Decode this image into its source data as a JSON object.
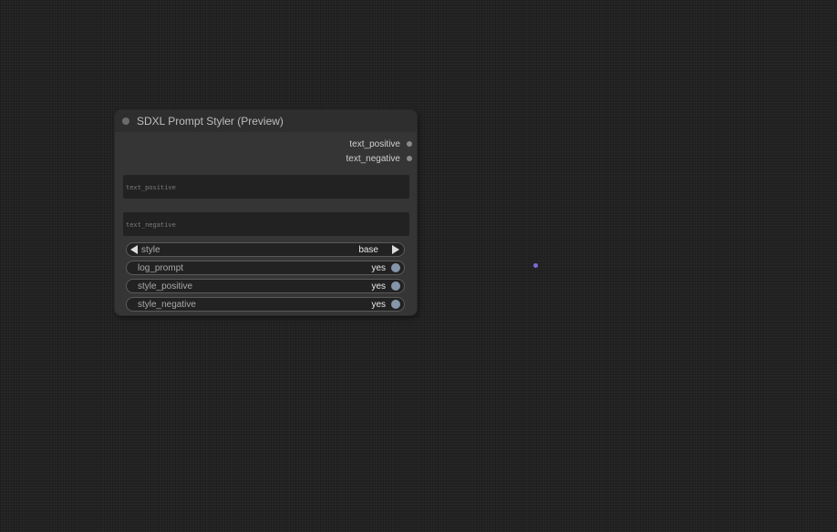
{
  "node": {
    "title": "SDXL Prompt Styler (Preview)",
    "outputs": [
      {
        "label": "text_positive"
      },
      {
        "label": "text_negative"
      }
    ],
    "textareas": [
      {
        "placeholder": "text_positive"
      },
      {
        "placeholder": "text_negative"
      }
    ],
    "combo": {
      "label": "style",
      "value": "base"
    },
    "toggles": [
      {
        "label": "log_prompt",
        "value": "yes"
      },
      {
        "label": "style_positive",
        "value": "yes"
      },
      {
        "label": "style_negative",
        "value": "yes"
      }
    ]
  },
  "colors": {
    "canvas_bg": "#222222",
    "node_bg": "#353535",
    "node_header": "#2e2e2e",
    "toggle_on": "#8596aa",
    "link_point": "#7c6bdc"
  },
  "icons": {
    "collapse": "node-collapse-dot-icon",
    "combo_prev": "triangle-left-icon",
    "combo_next": "triangle-right-icon"
  }
}
